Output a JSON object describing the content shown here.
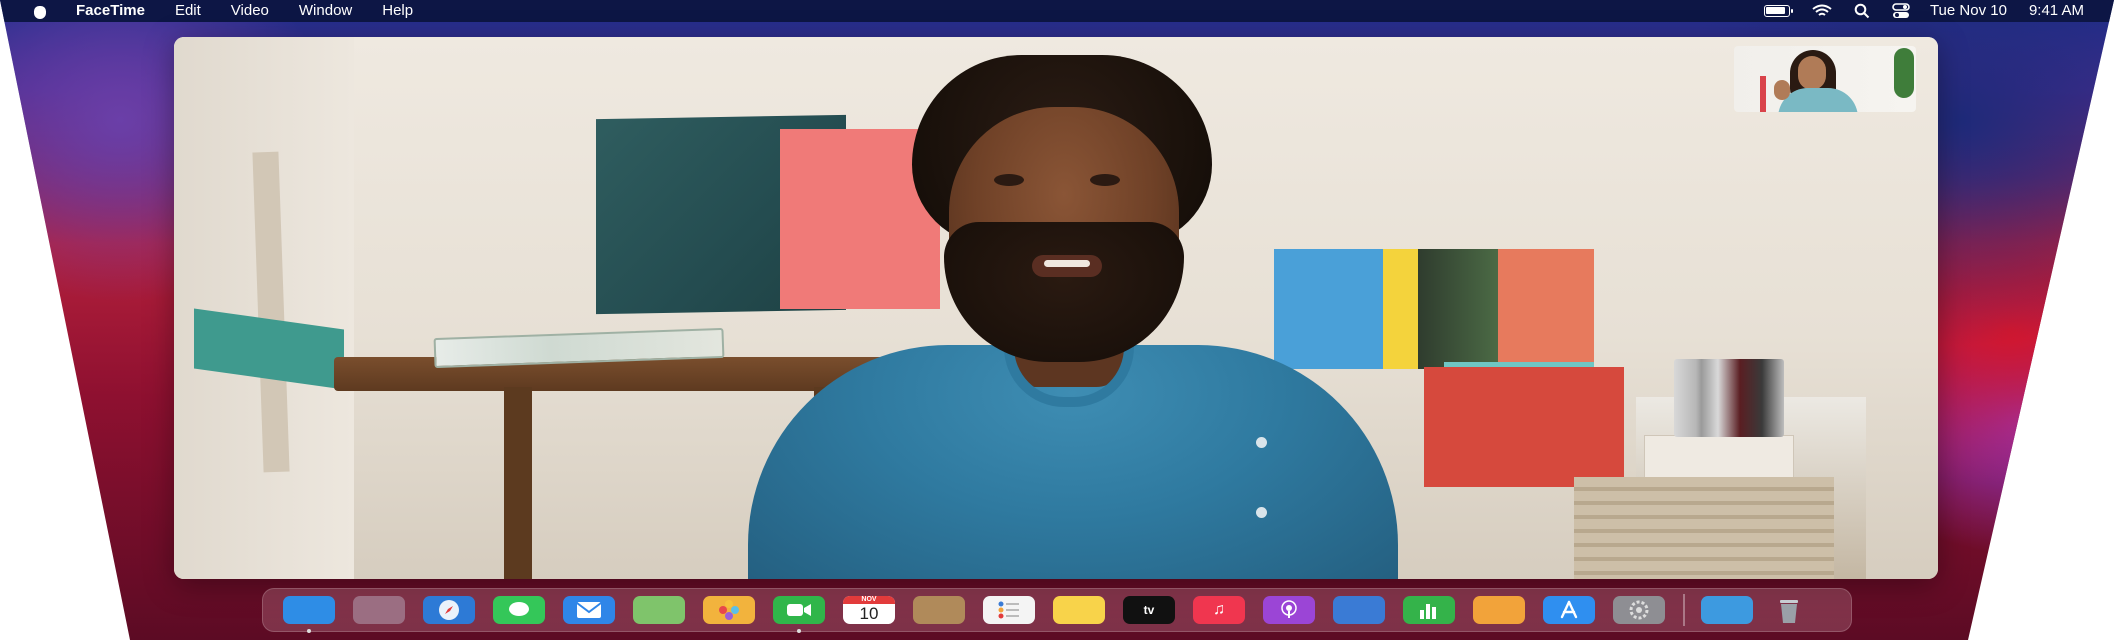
{
  "menubar": {
    "app_name": "FaceTime",
    "menus": [
      "Edit",
      "Video",
      "Window",
      "Help"
    ],
    "date": "Tue Nov 10",
    "time": "9:41 AM"
  },
  "icons": {
    "apple": "apple-logo-icon",
    "battery": "battery-icon",
    "wifi": "wifi-icon",
    "search": "spotlight-search-icon",
    "control_center": "control-center-icon"
  },
  "dock": {
    "items": [
      {
        "name": "finder",
        "color": "#2e8de6"
      },
      {
        "name": "launchpad",
        "color": "#9b6e82"
      },
      {
        "name": "safari",
        "color": "#2d7ad6"
      },
      {
        "name": "messages",
        "color": "#34c759"
      },
      {
        "name": "mail",
        "color": "#2f86e8"
      },
      {
        "name": "maps",
        "color": "#7fc46b"
      },
      {
        "name": "photos",
        "color": "#f2b33d"
      },
      {
        "name": "facetime",
        "color": "#30b64a"
      },
      {
        "name": "calendar",
        "color": "#ffffff"
      },
      {
        "name": "contacts",
        "color": "#b08a5a"
      },
      {
        "name": "reminders",
        "color": "#f4f4f4"
      },
      {
        "name": "notes",
        "color": "#f8d34a"
      },
      {
        "name": "tv",
        "color": "#111111"
      },
      {
        "name": "music",
        "color": "#f0364f"
      },
      {
        "name": "podcasts",
        "color": "#9b45d6"
      },
      {
        "name": "keynote",
        "color": "#3a7bd5"
      },
      {
        "name": "numbers",
        "color": "#34b34a"
      },
      {
        "name": "pages",
        "color": "#f2a33a"
      },
      {
        "name": "app-store",
        "color": "#2f8ff0"
      },
      {
        "name": "system-preferences",
        "color": "#8e8e93"
      },
      {
        "name": "downloads",
        "color": "#3d9ae0"
      },
      {
        "name": "trash",
        "color": "#9aa0a8"
      }
    ],
    "calendar_month": "NOV",
    "calendar_day": "10",
    "tv_label": "tv"
  },
  "colors": {
    "menubar_bg": "#0d1645",
    "shirt": "#2f7aa0"
  }
}
